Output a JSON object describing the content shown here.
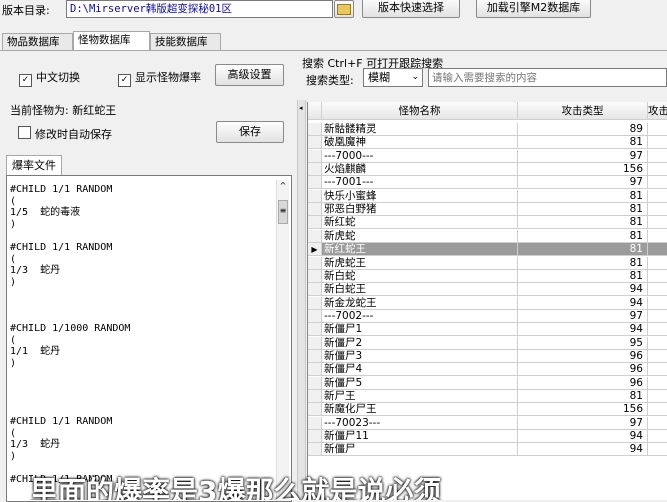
{
  "top": {
    "dir_label": "版本目录:",
    "dir_value": "D:\\Mirserver韩版超变探秘01区",
    "quick_select": "版本快速选择",
    "load_db": "加载引擎M2数据库"
  },
  "tabs": [
    "物品数据库",
    "怪物数据库",
    "技能数据库"
  ],
  "options": {
    "cn_switch": "中文切换",
    "show_drop": "显示怪物爆率",
    "advanced": "高级设置"
  },
  "search": {
    "title": "搜索  Ctrl+F 可打开跟踪搜索",
    "type_label": "搜索类型:",
    "type_value": "模糊",
    "placeholder": "请输入需要搜索的内容"
  },
  "current": {
    "label": "当前怪物为: 新红蛇王",
    "autosave": "修改时自动保存",
    "save": "保存"
  },
  "file_tab": "爆率文件",
  "editor_lines": [
    "#CHILD 1/1 RANDOM",
    "(",
    "1/5  蛇的毒液",
    ")",
    "",
    "#CHILD 1/1 RANDOM",
    "(",
    "1/3  蛇丹",
    ")",
    "",
    "",
    "",
    "#CHILD 1/1000 RANDOM",
    "(",
    "1/1  蛇丹",
    ")",
    "",
    "",
    "",
    "",
    "#CHILD 1/1 RANDOM",
    "(",
    "1/3  蛇丹",
    ")",
    "",
    "#CHILD 1/1 RANDOM"
  ],
  "grid": {
    "headers": [
      "怪物名称",
      "攻击类型",
      "攻击"
    ],
    "rows": [
      {
        "name": "新骷髅精灵",
        "type": "89"
      },
      {
        "name": "破凰魔神",
        "type": "81"
      },
      {
        "name": "---7000---",
        "type": "97"
      },
      {
        "name": "火焰麒麟",
        "type": "156"
      },
      {
        "name": "---7001---",
        "type": "97"
      },
      {
        "name": "快乐小蜜蜂",
        "type": "81"
      },
      {
        "name": "邪恶白野猪",
        "type": "81"
      },
      {
        "name": "新红蛇",
        "type": "81"
      },
      {
        "name": "新虎蛇",
        "type": "81"
      },
      {
        "name": "新红蛇王",
        "type": "81",
        "selected": true
      },
      {
        "name": "新虎蛇王",
        "type": "81"
      },
      {
        "name": "新白蛇",
        "type": "81"
      },
      {
        "name": "新白蛇王",
        "type": "94"
      },
      {
        "name": "新金龙蛇王",
        "type": "94"
      },
      {
        "name": "---7002---",
        "type": "97"
      },
      {
        "name": "新僵尸1",
        "type": "94"
      },
      {
        "name": "新僵尸2",
        "type": "95"
      },
      {
        "name": "新僵尸3",
        "type": "96"
      },
      {
        "name": "新僵尸4",
        "type": "96"
      },
      {
        "name": "新僵尸5",
        "type": "96"
      },
      {
        "name": "新尸王",
        "type": "81"
      },
      {
        "name": "新魔化尸王",
        "type": "156"
      },
      {
        "name": "---70023---",
        "type": "97"
      },
      {
        "name": "新僵尸11",
        "type": "94"
      },
      {
        "name": "新僵尸",
        "type": "94"
      }
    ]
  },
  "subtitle": "里面的爆率是3爆那么就是说必须"
}
